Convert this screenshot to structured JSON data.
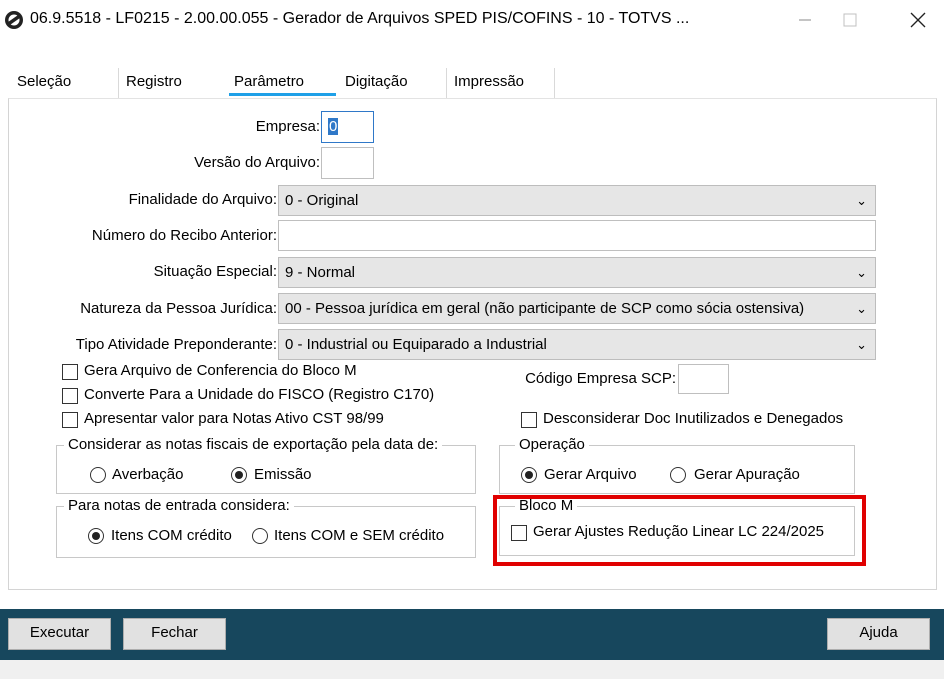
{
  "window": {
    "title": "06.9.5518 - LF0215 - 2.00.00.055 - Gerador de Arquivos SPED PIS/COFINS - 10 - TOTVS ...",
    "minimize": "—",
    "close": "✕"
  },
  "tabs": [
    {
      "label": "Seleção"
    },
    {
      "label": "Registro"
    },
    {
      "label": "Parâmetro"
    },
    {
      "label": "Digitação"
    },
    {
      "label": "Impressão"
    }
  ],
  "active_tab": "Parâmetro",
  "form": {
    "empresa": {
      "label": "Empresa:",
      "value": "0"
    },
    "versao": {
      "label": "Versão do Arquivo:",
      "value": ""
    },
    "finalidade": {
      "label": "Finalidade do Arquivo:",
      "value": "0 - Original"
    },
    "recibo": {
      "label": "Número do Recibo Anterior:",
      "value": ""
    },
    "situacao": {
      "label": "Situação Especial:",
      "value": "9 - Normal"
    },
    "natureza": {
      "label": "Natureza da Pessoa Jurídica:",
      "value": "00 - Pessoa jurídica em geral (não participante de SCP como sócia ostensiva)"
    },
    "atividade": {
      "label": "Tipo Atividade Preponderante:",
      "value": "0 - Industrial ou Equiparado a Industrial"
    },
    "codigo_scp": {
      "label": "Código Empresa SCP:",
      "value": ""
    }
  },
  "checkboxes": {
    "bloco_m_conf": "Gera Arquivo de Conferencia do Bloco M",
    "converte_fisco": "Converte Para a Unidade do FISCO (Registro C170)",
    "valor_notas": "Apresentar valor para Notas Ativo CST 98/99",
    "desconsiderar": "Desconsiderar Doc Inutilizados e Denegados"
  },
  "groups": {
    "exportacao": {
      "title": "Considerar as notas fiscais de exportação pela data de:",
      "options": [
        "Averbação",
        "Emissão"
      ],
      "selected": "Emissão"
    },
    "operacao": {
      "title": "Operação",
      "options": [
        "Gerar Arquivo",
        "Gerar Apuração"
      ],
      "selected": "Gerar Arquivo"
    },
    "entrada": {
      "title": "Para notas de entrada considera:",
      "options": [
        "Itens COM crédito",
        "Itens COM e SEM crédito"
      ],
      "selected": "Itens COM crédito"
    },
    "bloco_m": {
      "title": "Bloco M",
      "checkbox": "Gerar Ajustes Redução Linear LC 224/2025"
    }
  },
  "buttons": {
    "executar": "Executar",
    "fechar": "Fechar",
    "ajuda": "Ajuda"
  },
  "colors": {
    "footer": "#17475d",
    "tab_accent": "#1ea0e8",
    "highlight": "#e00000"
  }
}
